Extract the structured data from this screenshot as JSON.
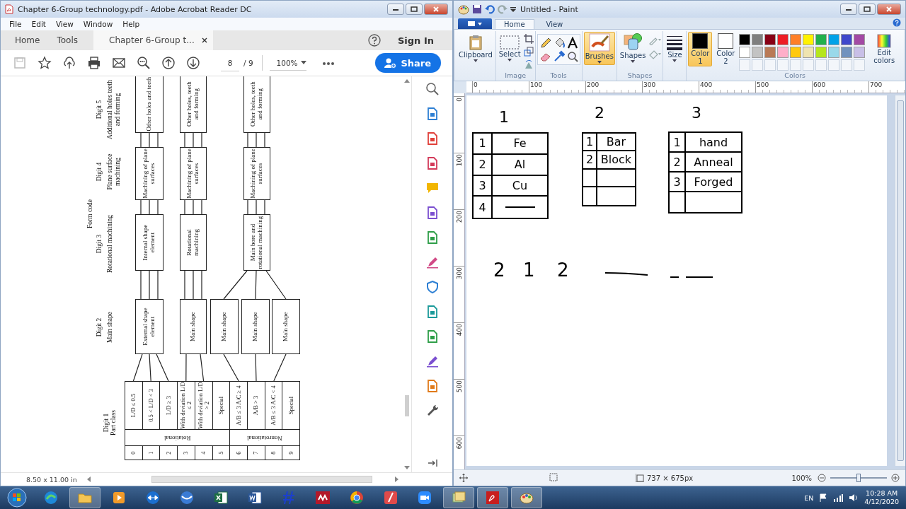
{
  "acrobat": {
    "title": "Chapter 6-Group technology.pdf - Adobe Acrobat Reader DC",
    "menu": [
      "File",
      "Edit",
      "View",
      "Window",
      "Help"
    ],
    "nav_tabs": [
      {
        "label": "Home",
        "selected": false
      },
      {
        "label": "Tools",
        "selected": false
      },
      {
        "label": "Chapter 6-Group t...",
        "selected": true
      }
    ],
    "sign_in": "Sign In",
    "page": {
      "current": "8",
      "total": "/ 9"
    },
    "zoom": "100%",
    "share": "Share",
    "document": {
      "form_code": "Form code",
      "digits": [
        {
          "label": "Digit 1",
          "caption": "Part class"
        },
        {
          "label": "Digit 2",
          "caption": "Main shape"
        },
        {
          "label": "Digit 3",
          "caption": "Rotational machining"
        },
        {
          "label": "Digit 4",
          "caption": "Plane surface machining"
        },
        {
          "label": "Digit 5",
          "caption": "Additional holes teeth and forming"
        }
      ],
      "groups": [
        {
          "label": "Rotational",
          "classes": [
            {
              "digit": "0",
              "description": "L/D ≤ 0.5"
            },
            {
              "digit": "1",
              "description": "0.5 < L/D < 3"
            },
            {
              "digit": "2",
              "description": "L/D ≥ 3"
            },
            {
              "digit": "3",
              "description": "With deviation L/D ≤ 2"
            },
            {
              "digit": "4",
              "description": "With deviation L/D > 2"
            },
            {
              "digit": "5",
              "description": "Special"
            }
          ]
        },
        {
          "label": "Nonrotational",
          "classes": [
            {
              "digit": "6",
              "description": "A/B ≤ 3 A/C ≥ 4"
            },
            {
              "digit": "7",
              "description": "A/B > 3"
            },
            {
              "digit": "8",
              "description": "A/B ≤ 3 A/C < 4"
            },
            {
              "digit": "9",
              "description": "Special"
            }
          ]
        }
      ],
      "branches": [
        {
          "main_shapes": [
            "External shape element"
          ],
          "rotational": "Internal shape element",
          "plane": "Machining of plane surfaces",
          "holes": "Other holes and teeth"
        },
        {
          "main_shapes": [
            "Main shape"
          ],
          "rotational": "Rotational machining",
          "plane": "Machining of plane surfaces",
          "holes": "Other holes, teeth and forming"
        },
        {
          "main_shapes": [
            "Main shape",
            "Main shape",
            "Main shape"
          ],
          "rotational": "Main bore and rotational machining",
          "plane": "Machining of plane surfaces",
          "holes": "Other holes, teeth and forming"
        }
      ]
    },
    "page_size": "8.50 x 11.00 in"
  },
  "paint": {
    "title": "Untitled - Paint",
    "tabs": [
      {
        "label": "Home",
        "selected": true
      },
      {
        "label": "View",
        "selected": false
      }
    ],
    "clipboard": "Clipboard",
    "select": "Select",
    "brushes": {
      "label": "Brushes",
      "selected": true
    },
    "shapes": "Shapes",
    "size": "Size",
    "colors": [
      {
        "label": "Color 1",
        "color": "#000000",
        "selected": true
      },
      {
        "label": "Color 2",
        "color": "#ffffff",
        "selected": false
      }
    ],
    "palette": [
      {
        "color": "#000000"
      },
      {
        "color": "#7f7f7f"
      },
      {
        "color": "#880015"
      },
      {
        "color": "#ed1c24"
      },
      {
        "color": "#ff7f27"
      },
      {
        "color": "#fff200"
      },
      {
        "color": "#22b14c"
      },
      {
        "color": "#00a2e8"
      },
      {
        "color": "#3f48cc"
      },
      {
        "color": "#a349a4"
      },
      {
        "color": "#ffffff"
      },
      {
        "color": "#c3c3c3"
      },
      {
        "color": "#b97a57"
      },
      {
        "color": "#ffaec9"
      },
      {
        "color": "#ffc90e"
      },
      {
        "color": "#efe4b0"
      },
      {
        "color": "#b5e61d"
      },
      {
        "color": "#99d9ea"
      },
      {
        "color": "#7092be"
      },
      {
        "color": "#c8bfe7"
      }
    ],
    "edit_colors": "Edit colors",
    "groups": [
      "Image",
      "Tools",
      "Shapes",
      "Colors"
    ],
    "ruler_h": [
      "0",
      "100",
      "200",
      "300",
      "400",
      "500",
      "600",
      "700"
    ],
    "ruler_v": [
      "0",
      "100",
      "200",
      "300",
      "400",
      "500",
      "600"
    ],
    "canvas": {
      "headings": [
        "1",
        "2",
        "3"
      ],
      "tables": [
        {
          "rows": [
            {
              "num": "1",
              "value": "Fe"
            },
            {
              "num": "2",
              "value": "Al"
            },
            {
              "num": "3",
              "value": "Cu"
            },
            {
              "num": "4",
              "kind": "dash"
            }
          ]
        },
        {
          "rows": [
            {
              "num": "1",
              "value": "Bar"
            },
            {
              "num": "2",
              "value": "Block"
            }
          ]
        },
        {
          "rows": [
            {
              "num": "1",
              "value": "hand"
            },
            {
              "num": "2",
              "value": "Anneal"
            },
            {
              "num": "3",
              "value": "Forged"
            }
          ]
        }
      ],
      "code": [
        "2",
        "1",
        "2"
      ]
    },
    "size_readout": "737 × 675px",
    "zoom": "100%",
    "zoom_slider": {
      "level": 0.5
    }
  },
  "taskbar": {
    "language": "EN",
    "time": "10:28 AM",
    "date": "4/12/2020"
  }
}
